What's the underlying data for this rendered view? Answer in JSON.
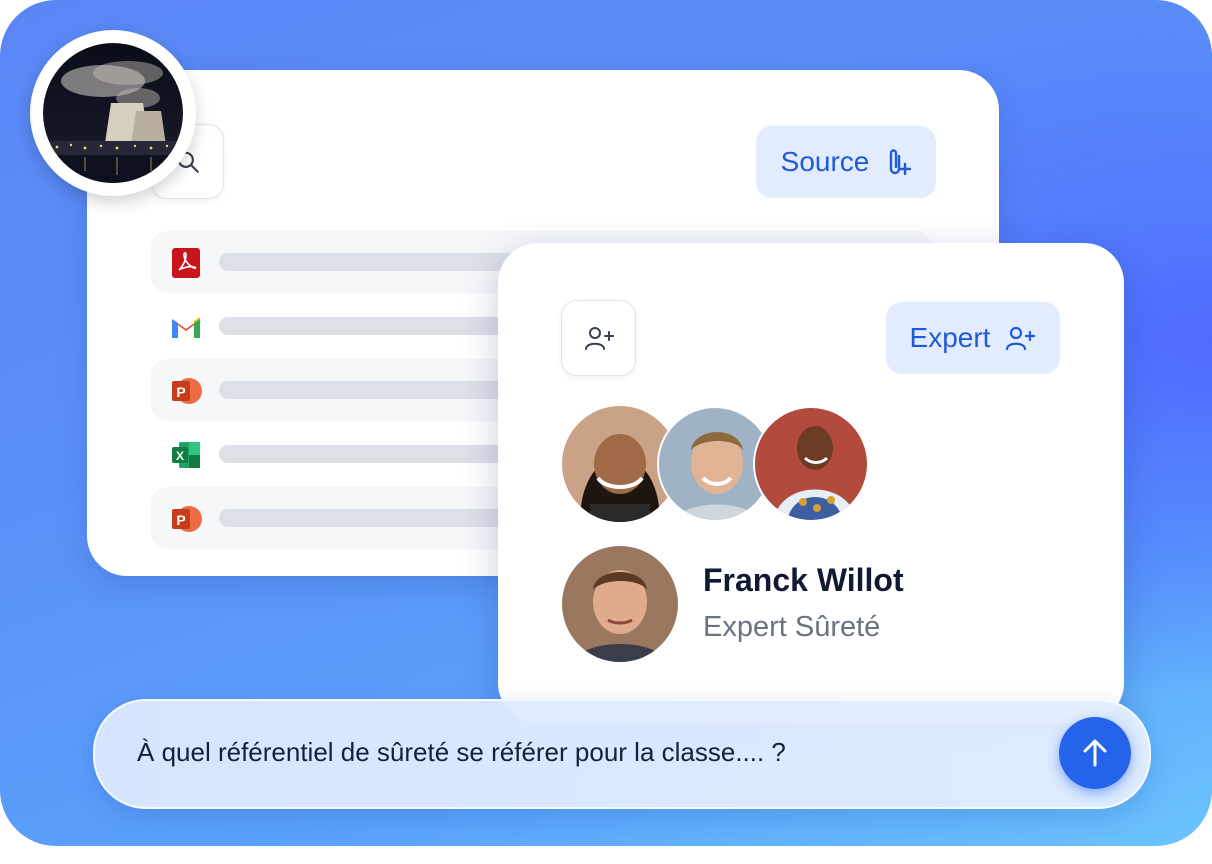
{
  "toolbar": {
    "source_label": "Source"
  },
  "files": [
    {
      "icon": "pdf-icon",
      "color": "#c8151b"
    },
    {
      "icon": "gmail-icon",
      "color": "#ea4335"
    },
    {
      "icon": "powerpoint-icon",
      "color": "#d24726"
    },
    {
      "icon": "excel-icon",
      "color": "#1d6f42"
    },
    {
      "icon": "powerpoint-icon",
      "color": "#d24726"
    }
  ],
  "experts_panel": {
    "button_label": "Expert",
    "expert_name": "Franck Willot",
    "expert_role": "Expert Sûreté"
  },
  "chat": {
    "message": "À quel référentiel de sûreté se référer pour la classe.... ?"
  },
  "colors": {
    "accent": "#1f5bd8",
    "button_bg": "#e3ebff",
    "send_button": "#2563eb"
  }
}
